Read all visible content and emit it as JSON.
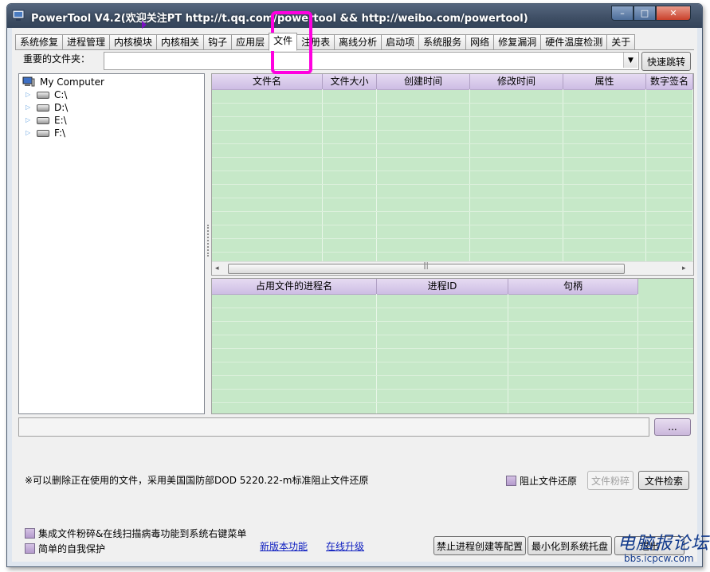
{
  "window": {
    "title": "PowerTool V4.2(欢迎关注PT http://t.qq.com/powertool && http://weibo.com/powertool)",
    "min_glyph": "–",
    "max_glyph": "□",
    "close_glyph": "✕"
  },
  "tabs": [
    {
      "label": "系统修复",
      "active": false
    },
    {
      "label": "进程管理",
      "active": false
    },
    {
      "label": "内核模块",
      "active": false
    },
    {
      "label": "内核相关",
      "active": false
    },
    {
      "label": "钩子",
      "active": false
    },
    {
      "label": "应用层",
      "active": false
    },
    {
      "label": "文件",
      "active": true
    },
    {
      "label": "注册表",
      "active": false
    },
    {
      "label": "离线分析",
      "active": false
    },
    {
      "label": "启动项",
      "active": false
    },
    {
      "label": "系统服务",
      "active": false
    },
    {
      "label": "网络",
      "active": false
    },
    {
      "label": "修复漏洞",
      "active": false
    },
    {
      "label": "硬件温度检测",
      "active": false
    },
    {
      "label": "关于",
      "active": false
    }
  ],
  "folder": {
    "label": "重要的文件夹：",
    "value": "",
    "arrow": "▼",
    "jump_button": "快速跳转"
  },
  "tree": {
    "root": "My Computer",
    "drives": [
      "C:\\",
      "D:\\",
      "E:\\",
      "F:\\"
    ],
    "expand_glyph": "▷"
  },
  "file_table": {
    "columns": [
      "文件名",
      "文件大小",
      "创建时间",
      "修改时间",
      "属性",
      "数字签名"
    ],
    "rows": []
  },
  "proc_table": {
    "columns": [
      "占用文件的进程名",
      "进程ID",
      "句柄"
    ],
    "rows": []
  },
  "scroll": {
    "left": "◂",
    "right": "▸",
    "grip": "|||"
  },
  "path": {
    "value": "",
    "browse_button": "..."
  },
  "note": "※可以删除正在使用的文件，采用美国国防部DOD 5220.22-m标准阻止文件还原",
  "actions": {
    "prevent_restore_label": "阻止文件还原",
    "shred_button": "文件粉碎",
    "search_button": "文件检索"
  },
  "bottom": {
    "context_menu_label": "集成文件粉碎&在线扫描病毒功能到系统右键菜单",
    "self_protect_label": "简单的自我保护",
    "new_features_link": "新版本功能",
    "online_update_link": "在线升级",
    "block_process_button": "禁止进程创建等配置",
    "minimize_tray_button": "最小化到系统托盘",
    "exit_button": "退出"
  },
  "watermark": {
    "main": "电脑报论坛",
    "url": "bbs.icpcw.com"
  },
  "colors": {
    "grid_bg": "#c6e8c8",
    "header_bg": "#cdbde4",
    "highlight": "#ff00e0",
    "link": "#1020c0"
  }
}
